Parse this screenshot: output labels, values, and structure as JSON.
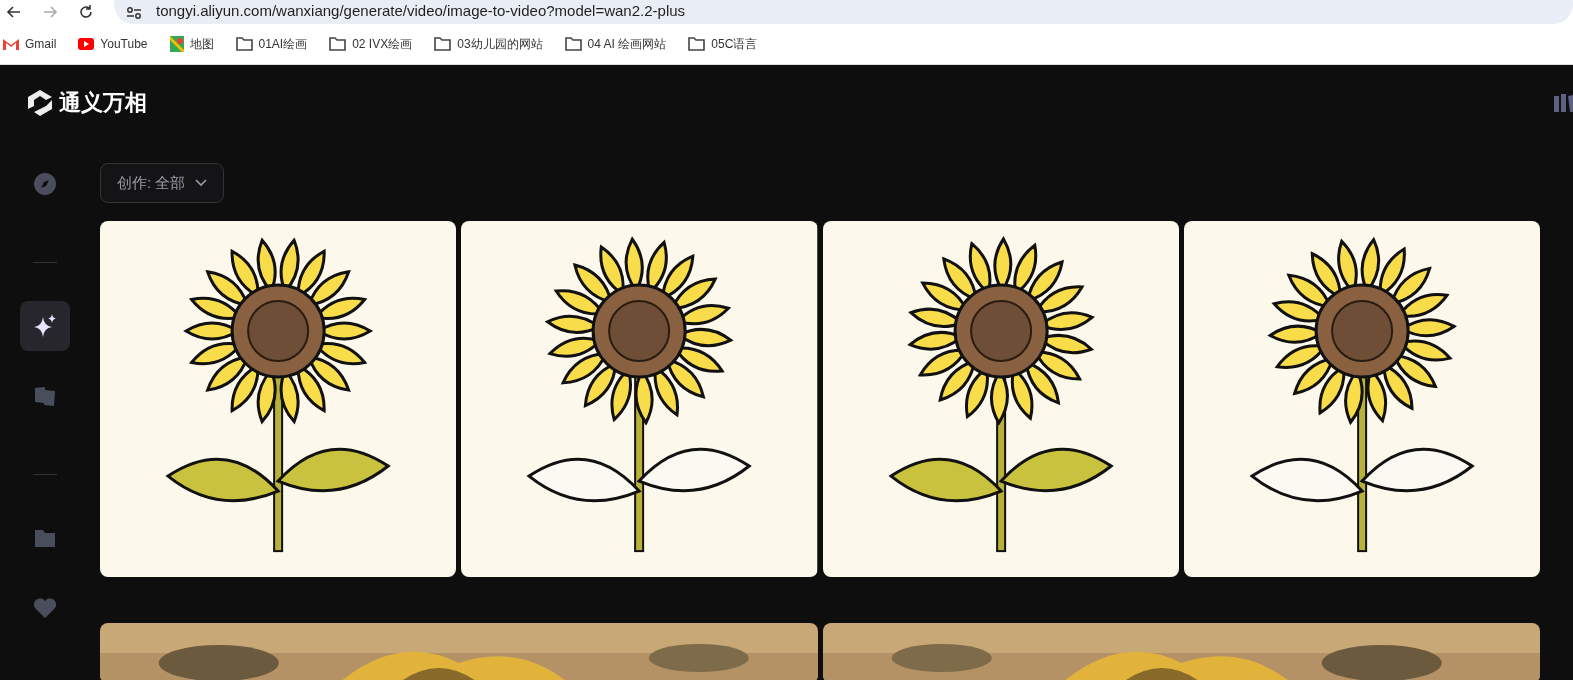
{
  "browser": {
    "url": "tongyi.aliyun.com/wanxiang/generate/video/image-to-video?model=wan2.2-plus",
    "bookmarks": [
      {
        "kind": "gmail",
        "label": "Gmail"
      },
      {
        "kind": "youtube",
        "label": "YouTube"
      },
      {
        "kind": "maps",
        "label": "地图"
      },
      {
        "kind": "folder",
        "label": "01AI绘画"
      },
      {
        "kind": "folder",
        "label": "02 IVX绘画"
      },
      {
        "kind": "folder",
        "label": "03幼儿园的网站"
      },
      {
        "kind": "folder",
        "label": "04 AI 绘画网站"
      },
      {
        "kind": "folder",
        "label": "05C语言"
      }
    ]
  },
  "app": {
    "logo": "通义万相",
    "sidebar": {
      "items": [
        {
          "kind": "compass",
          "selected": false
        },
        {
          "kind": "divider"
        },
        {
          "kind": "sparkle",
          "selected": true
        },
        {
          "kind": "cards",
          "selected": false
        },
        {
          "kind": "divider"
        },
        {
          "kind": "folder",
          "selected": false
        },
        {
          "kind": "heart",
          "selected": false
        }
      ]
    },
    "filter": {
      "label": "创作: 全部"
    }
  }
}
